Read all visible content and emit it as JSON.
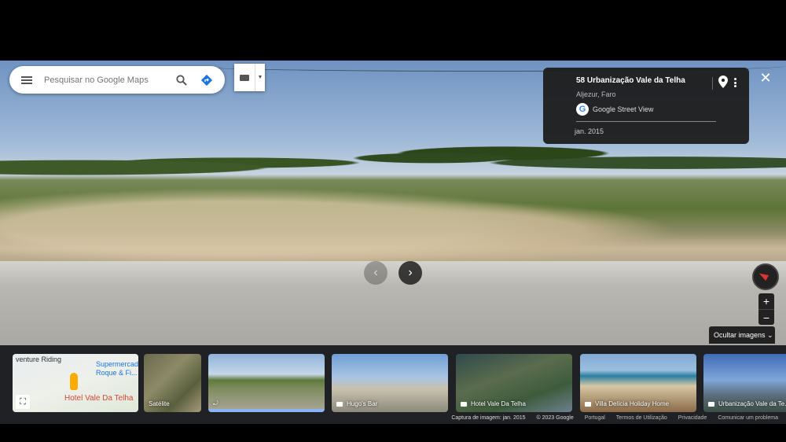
{
  "search": {
    "placeholder": "Pesquisar no Google Maps"
  },
  "info_card": {
    "title": "58 Urbanização Vale da Telha",
    "subtitle": "Aljezur, Faro",
    "source": "Google Street View",
    "date": "jan. 2015"
  },
  "controls": {
    "close": "✕",
    "nav_left": "‹",
    "nav_right": "›",
    "zoom_in": "+",
    "zoom_out": "−",
    "hide_images": "Ocultar imagens"
  },
  "thumbnails": {
    "map_texts": [
      "venture Riding",
      "Supermercado Roque & Fi...",
      "Hotel Vale Da Telha"
    ],
    "satellite": "Satélite",
    "items": [
      {
        "label": "Hugo's Bar"
      },
      {
        "label": "Hotel Vale Da Telha"
      },
      {
        "label": "Villa Delícia Holiday Home"
      },
      {
        "label": "Urbanização Vale da Te..."
      }
    ]
  },
  "footer": {
    "capture": "Captura de imagem: jan. 2015",
    "copyright": "© 2023 Google",
    "language": "Portugal",
    "terms": "Termos de Utilização",
    "privacy": "Privacidade",
    "report": "Comunicar um problema"
  },
  "colors": {
    "accent_blue": "#1a73e8",
    "panel_dark": "#202124"
  },
  "icons": [
    "menu-icon",
    "search-icon",
    "directions-icon",
    "keyboard-icon",
    "pin-icon",
    "more-icon",
    "close-icon",
    "compass-icon",
    "camera-icon",
    "expand-icon"
  ]
}
